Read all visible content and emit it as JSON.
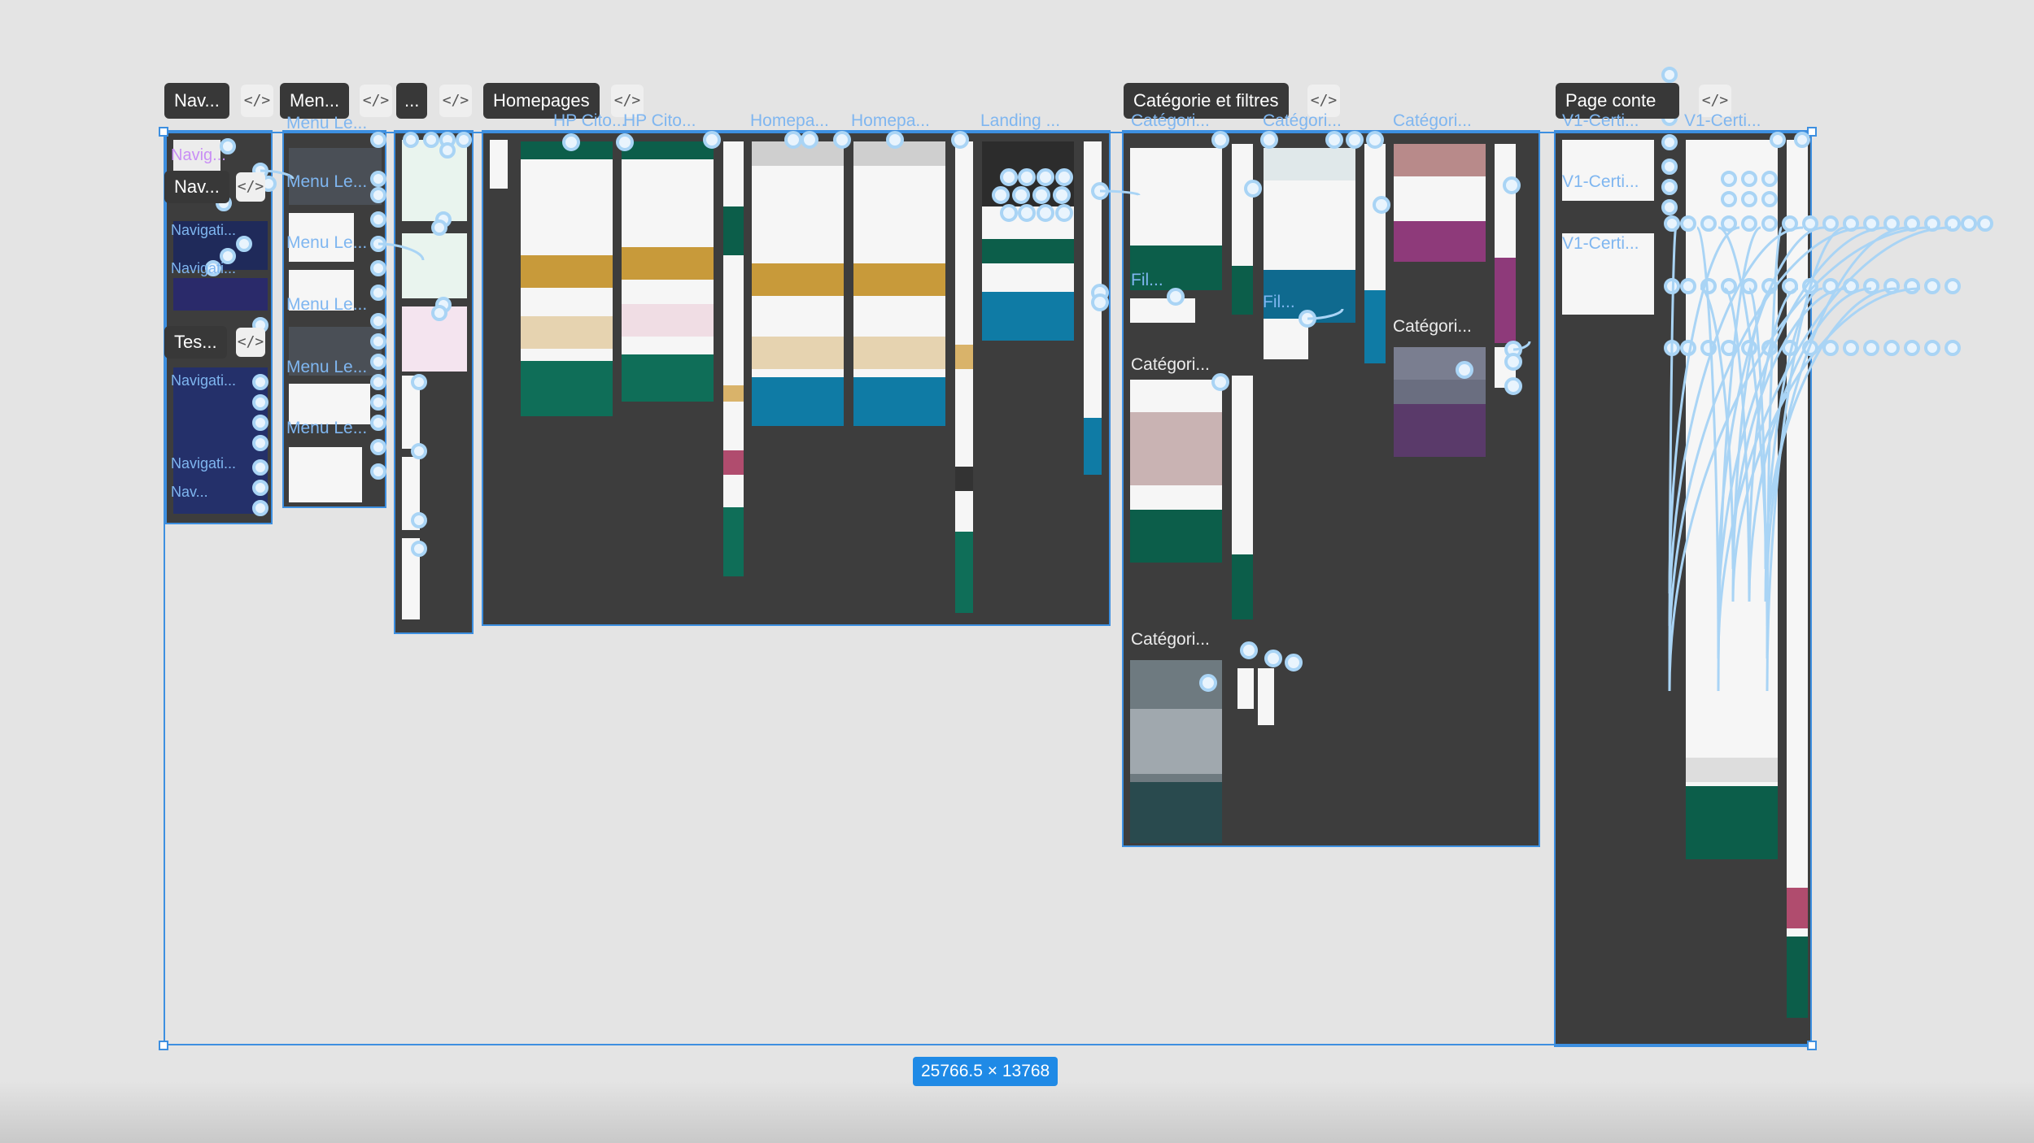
{
  "canvas": {
    "background": "#e4e4e4",
    "section_fill": "#3d3d3d",
    "selection_color": "#3d8fe0",
    "prototype_color": "#a9d4f5"
  },
  "selection": {
    "dimensions": "25766.5 × 13768"
  },
  "sections": [
    {
      "id": "nav",
      "label": "Nav...",
      "tag_labels": [
        "Nav...",
        "Tes..."
      ]
    },
    {
      "id": "menu",
      "label": "Men..."
    },
    {
      "id": "more",
      "label": "..."
    },
    {
      "id": "home",
      "label": "Homepages"
    },
    {
      "id": "cat",
      "label": "Catégorie et filtres"
    },
    {
      "id": "page",
      "label": "Page conte"
    }
  ],
  "frame_labels": {
    "menu": [
      "Menu Le...",
      "Menu Le...",
      "Menu Le...",
      "Menu Le...",
      "Menu Le...",
      "Menu Le..."
    ],
    "home": [
      "HP Cito...",
      "HP Cito...",
      "Homepa...",
      "Homepa...",
      "Landing ..."
    ],
    "cat": [
      "Catégori...",
      "Catégori...",
      "Catégori...",
      "Fil...",
      "Fil...",
      "Catégori...",
      "Catégori...",
      "Catégori..."
    ],
    "page": [
      "V1-Certi...",
      "V1-Certi...",
      "V1-Certi...",
      "V1-Certi..."
    ],
    "nav_small": [
      "Navig...",
      "Navigati...",
      "Navigati...",
      "Navigati...",
      "Navigati...",
      "Nav..."
    ]
  },
  "icons": {
    "code": "code-brackets-icon",
    "code_glyph": "</>"
  }
}
